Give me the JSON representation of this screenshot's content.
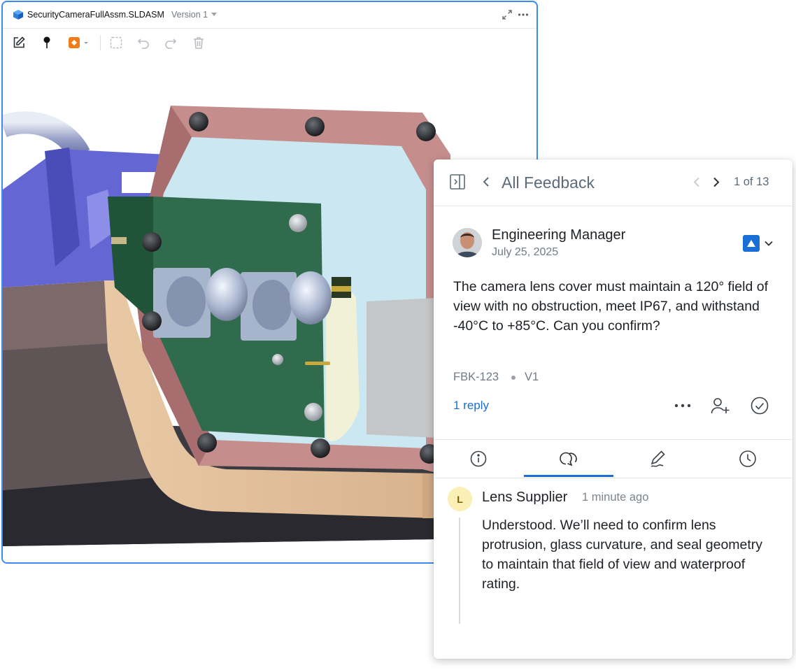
{
  "viewer": {
    "file_name": "SecurityCameraFullAssm.SLDASM",
    "version_label": "Version 1",
    "toolbar": {
      "tools": [
        "edit-icon",
        "pin-icon",
        "markup-shape-icon",
        "region-select-icon",
        "undo-icon",
        "redo-icon",
        "delete-icon"
      ]
    },
    "accent_color": "#3d8bf2"
  },
  "feedback_panel": {
    "title": "All Feedback",
    "counter": "1 of 13",
    "author": {
      "name": "Engineering Manager",
      "date": "July 25, 2025"
    },
    "status_color": "#1a6fd6",
    "body": "The camera lens cover must maintain a 120° field of view with no obstruction, meet IP67, and withstand -40°C to +85°C. Can you confirm?",
    "id": "FBK-123",
    "version": "V1",
    "reply_count_label": "1 reply",
    "tabs": [
      "info-icon",
      "comments-icon",
      "markup-icon",
      "history-icon"
    ],
    "active_tab": "comments",
    "reply": {
      "initial": "L",
      "name": "Lens Supplier",
      "time": "1 minute ago",
      "body": "Understood. We’ll need to confirm lens protrusion, glass curvature, and seal geometry to maintain that field of view and waterproof rating."
    }
  }
}
